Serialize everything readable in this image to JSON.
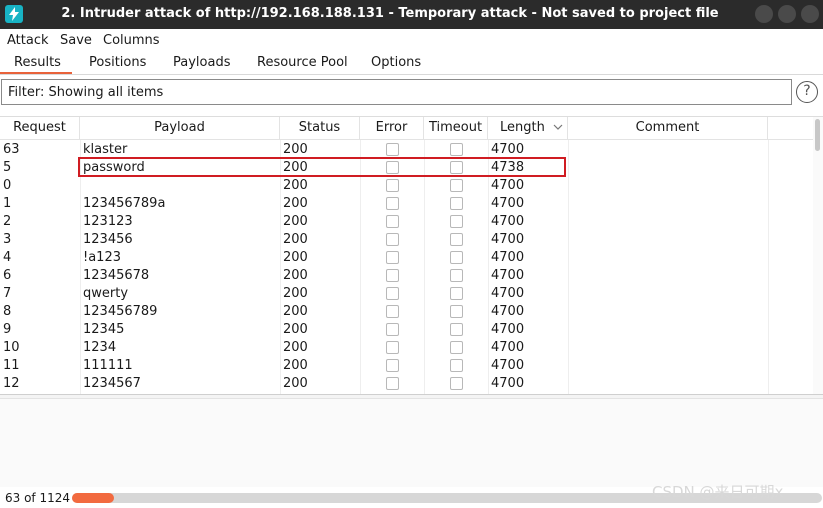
{
  "window": {
    "title": "2. Intruder attack of http://192.168.188.131 - Temporary attack - Not saved to project file"
  },
  "menu": [
    "Attack",
    "Save",
    "Columns"
  ],
  "tabs": [
    "Results",
    "Positions",
    "Payloads",
    "Resource Pool",
    "Options"
  ],
  "active_tab": "Results",
  "filter": {
    "text": "Filter: Showing all items"
  },
  "table": {
    "columns": [
      "Request",
      "Payload",
      "Status",
      "Error",
      "Timeout",
      "Length",
      "Comment"
    ],
    "sort_column": "Length",
    "rows": [
      {
        "request": "63",
        "payload": "klaster",
        "status": "200",
        "length": "4700"
      },
      {
        "request": "5",
        "payload": "password",
        "status": "200",
        "length": "4738"
      },
      {
        "request": "0",
        "payload": "",
        "status": "200",
        "length": "4700"
      },
      {
        "request": "1",
        "payload": "123456789a",
        "status": "200",
        "length": "4700"
      },
      {
        "request": "2",
        "payload": "123123",
        "status": "200",
        "length": "4700"
      },
      {
        "request": "3",
        "payload": "123456",
        "status": "200",
        "length": "4700"
      },
      {
        "request": "4",
        "payload": "!a123",
        "status": "200",
        "length": "4700"
      },
      {
        "request": "6",
        "payload": "12345678",
        "status": "200",
        "length": "4700"
      },
      {
        "request": "7",
        "payload": "qwerty",
        "status": "200",
        "length": "4700"
      },
      {
        "request": "8",
        "payload": "123456789",
        "status": "200",
        "length": "4700"
      },
      {
        "request": "9",
        "payload": "12345",
        "status": "200",
        "length": "4700"
      },
      {
        "request": "10",
        "payload": "1234",
        "status": "200",
        "length": "4700"
      },
      {
        "request": "11",
        "payload": "111111",
        "status": "200",
        "length": "4700"
      },
      {
        "request": "12",
        "payload": "1234567",
        "status": "200",
        "length": "4700"
      }
    ]
  },
  "status": {
    "count_text": "63 of 1124",
    "progress_fraction": 0.0561
  },
  "watermark": "CSDN @来日可期x",
  "colors": {
    "accent": "#e8623b",
    "highlight": "#d01c22",
    "titlebar": "#2b2b2b"
  }
}
